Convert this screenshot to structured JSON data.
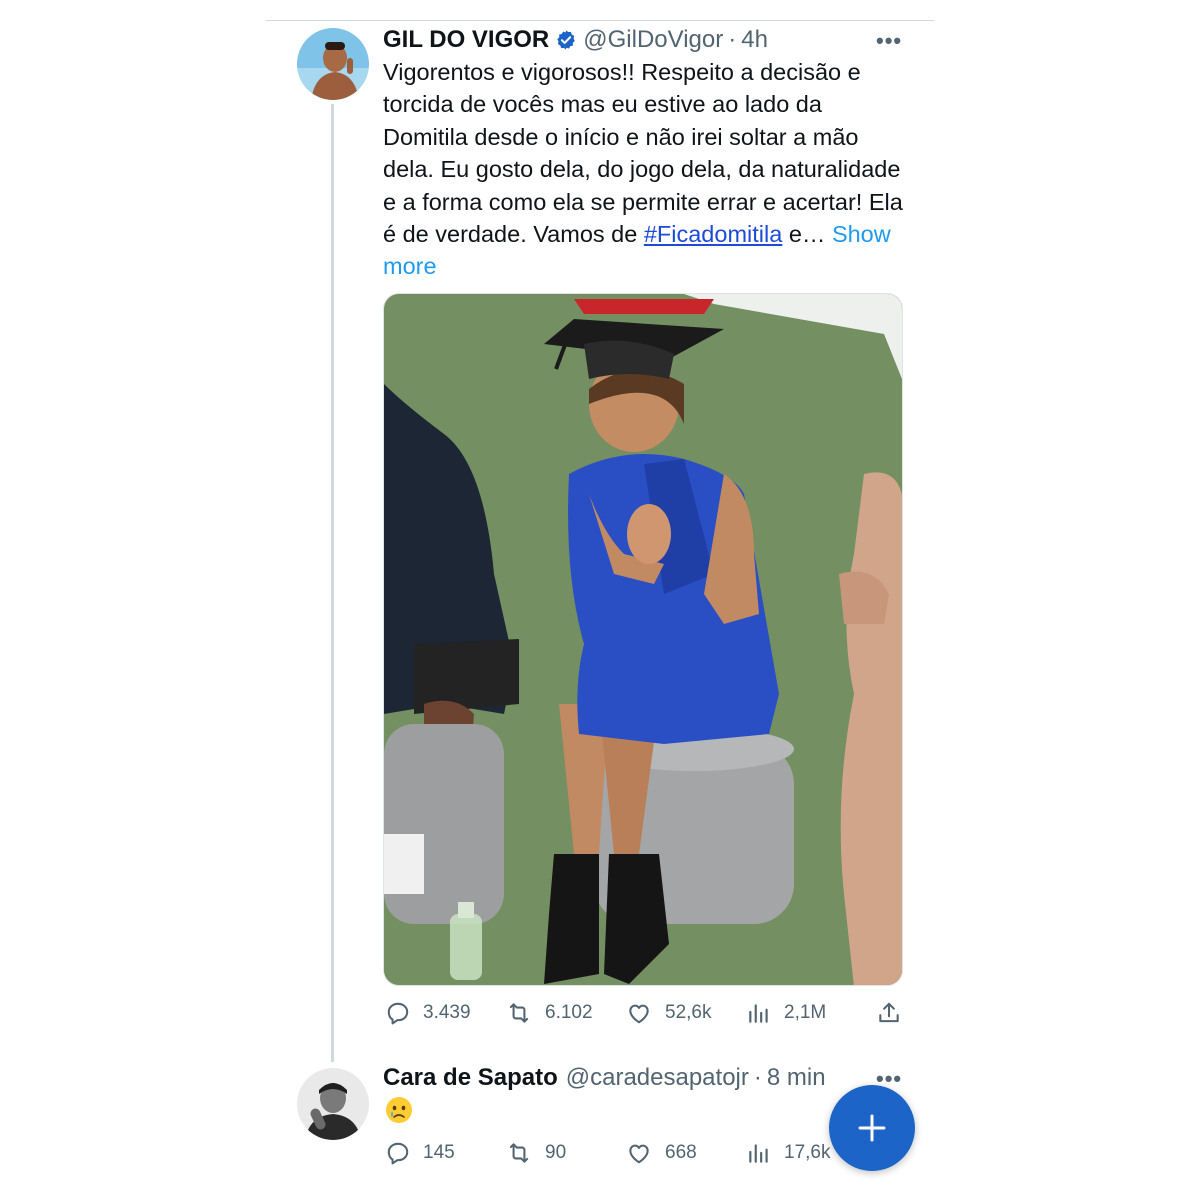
{
  "tweet": {
    "display_name": "GIL DO VIGOR",
    "handle": "@GilDoVigor",
    "separator": "·",
    "time": "4h",
    "more_label": "•••",
    "text_main": "Vigorentos e vigorosos!! Respeito a decisão e torcida de vocês mas eu estive ao lado da Domitila desde o início e não irei soltar a mão dela. Eu gosto dela, do jogo dela, da naturalidade e a forma como ela se permite errar e acertar! Ela é de verdade. Vamos de ",
    "hashtag": "#Ficadomitila",
    "text_after_hashtag": " e…",
    "show_more": "Show more",
    "stats": {
      "replies": "3.439",
      "retweets": "6.102",
      "likes": "52,6k",
      "views": "2,1M"
    }
  },
  "reply": {
    "display_name": "Cara de Sapato",
    "handle": "@caradesapatojr",
    "separator": "·",
    "time": "8 min",
    "more_label": "•••",
    "text": "😢",
    "stats": {
      "replies": "145",
      "retweets": "90",
      "likes": "668",
      "views": "17,6k"
    }
  },
  "colors": {
    "accent": "#1d9bf0",
    "fab": "#1d64c9",
    "muted": "#536471"
  },
  "icons": [
    "verified-badge-icon",
    "reply-icon",
    "retweet-icon",
    "like-icon",
    "views-icon",
    "share-icon",
    "plus-icon"
  ]
}
